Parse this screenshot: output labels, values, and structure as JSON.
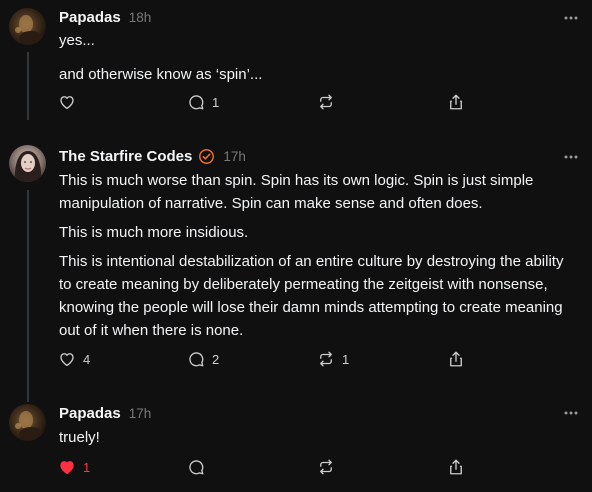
{
  "colors": {
    "background": "#101010",
    "text": "#f3f5f7",
    "muted": "#777777",
    "icon": "#cccccc",
    "like_active": "#ff3040",
    "verified_badge": "#f2742b",
    "thread_line": "#333638"
  },
  "posts": [
    {
      "username": "Papadas",
      "time": "18h",
      "verified": false,
      "paragraphs": [
        "yes...",
        "and otherwise know as ‘spin’..."
      ],
      "actions": {
        "like_count": "",
        "reply_count": "1",
        "repost_count": "",
        "liked": false
      },
      "icons": [
        "heart-icon",
        "comment-icon",
        "repost-icon",
        "share-icon",
        "more-icon"
      ]
    },
    {
      "username": "The Starfire Codes",
      "time": "17h",
      "verified": true,
      "paragraphs": [
        "This is much worse than spin. Spin has its own logic. Spin is just simple manipulation of narrative. Spin can make sense and often does.",
        "This is much more insidious.",
        "This is intentional destabilization of an entire culture by destroying the ability to create meaning by deliberately permeating the zeitgeist with nonsense, knowing the people will lose their damn minds attempting to create meaning out of it when there is none."
      ],
      "actions": {
        "like_count": "4",
        "reply_count": "2",
        "repost_count": "1",
        "liked": false
      },
      "icons": [
        "heart-icon",
        "comment-icon",
        "repost-icon",
        "share-icon",
        "more-icon",
        "verified-badge-icon"
      ]
    },
    {
      "username": "Papadas",
      "time": "17h",
      "verified": false,
      "paragraphs": [
        "truely!"
      ],
      "actions": {
        "like_count": "1",
        "reply_count": "",
        "repost_count": "",
        "liked": true
      },
      "icons": [
        "heart-filled-icon",
        "comment-icon",
        "repost-icon",
        "share-icon",
        "more-icon"
      ]
    }
  ]
}
